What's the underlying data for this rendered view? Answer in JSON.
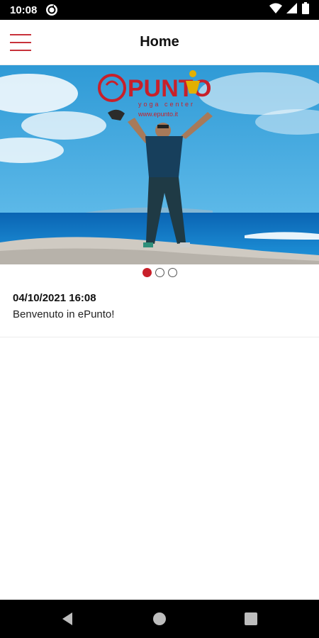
{
  "status_bar": {
    "time": "10:08",
    "icons": [
      "sync-icon",
      "wifi-icon",
      "signal-icon",
      "battery-icon"
    ]
  },
  "app_bar": {
    "title": "Home",
    "menu_icon": "hamburger-menu-icon",
    "accent_color": "#c8323b"
  },
  "banner": {
    "logo_text": "PUNTO",
    "logo_subtitle": "yoga center",
    "website": "www.epunto.it",
    "slides_total": 3,
    "active_slide": 1
  },
  "news": [
    {
      "date": "04/10/2021 16:08",
      "text": "Benvenuto in ePunto!"
    }
  ],
  "nav_bar": {
    "buttons": [
      "back-icon",
      "home-icon",
      "recents-icon"
    ]
  }
}
